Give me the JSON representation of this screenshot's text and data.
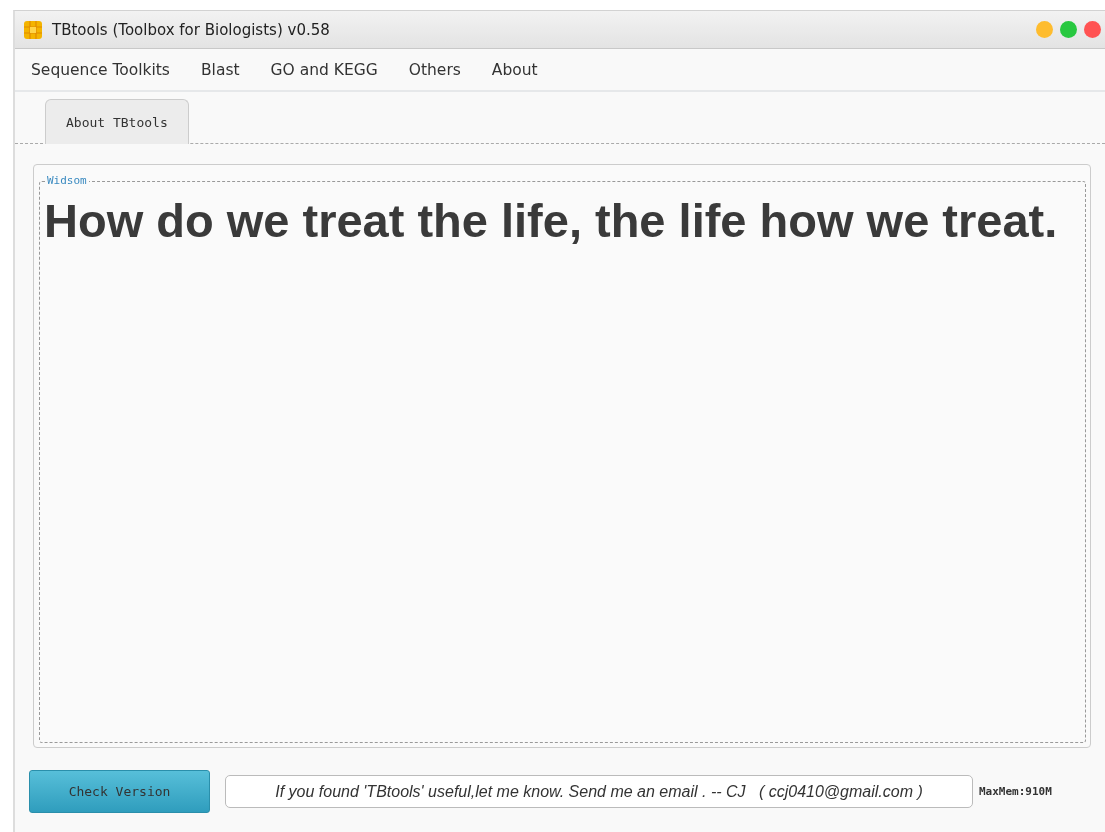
{
  "window": {
    "title": "TBtools (Toolbox for Biologists) v0.58",
    "controls": [
      {
        "color": "#febc2e"
      },
      {
        "color": "#28c840"
      },
      {
        "color": "#ff5252"
      }
    ]
  },
  "menu": [
    "Sequence Toolkits",
    "Blast",
    "GO and KEGG",
    "Others",
    "About"
  ],
  "tabs": [
    {
      "label": "About TBtools",
      "selected": true
    }
  ],
  "panel": {
    "legend": "Widsom",
    "quote": "How do we treat the life, the life how we treat."
  },
  "footer": {
    "button": "Check Version",
    "message": "If you found 'TBtools' useful,let me know. Send me an email . -- CJ   ( ccj0410@gmail.com )",
    "memory": "MaxMem:910M"
  }
}
